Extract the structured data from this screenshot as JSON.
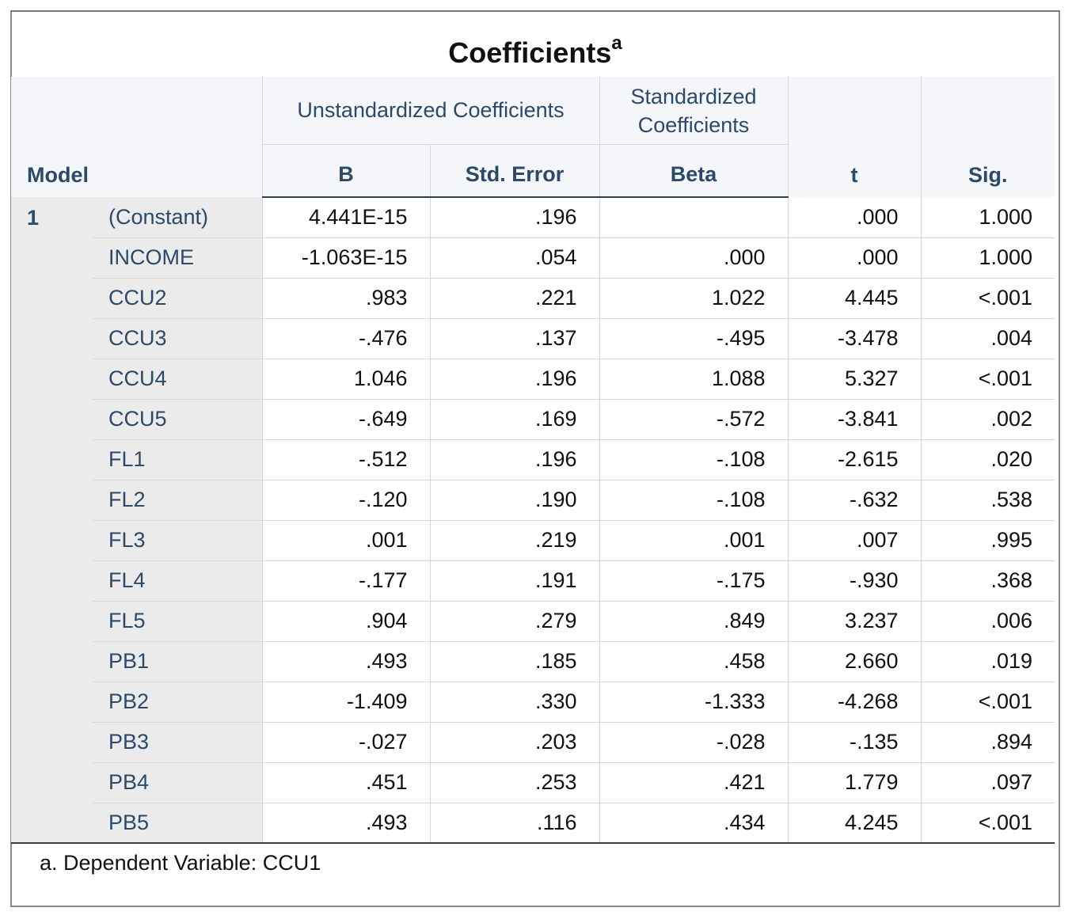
{
  "title": "Coefficients",
  "title_superscript": "a",
  "headers": {
    "model": "Model",
    "unstandardized": "Unstandardized Coefficients",
    "standardized": "Standardized Coefficients",
    "b": "B",
    "std_error": "Std. Error",
    "beta": "Beta",
    "t": "t",
    "sig": "Sig."
  },
  "model_number": "1",
  "rows": [
    {
      "var": "(Constant)",
      "b": "4.441E-15",
      "se": ".196",
      "beta": "",
      "t": ".000",
      "sig": "1.000"
    },
    {
      "var": "INCOME",
      "b": "-1.063E-15",
      "se": ".054",
      "beta": ".000",
      "t": ".000",
      "sig": "1.000"
    },
    {
      "var": "CCU2",
      "b": ".983",
      "se": ".221",
      "beta": "1.022",
      "t": "4.445",
      "sig": "<.001"
    },
    {
      "var": "CCU3",
      "b": "-.476",
      "se": ".137",
      "beta": "-.495",
      "t": "-3.478",
      "sig": ".004"
    },
    {
      "var": "CCU4",
      "b": "1.046",
      "se": ".196",
      "beta": "1.088",
      "t": "5.327",
      "sig": "<.001"
    },
    {
      "var": "CCU5",
      "b": "-.649",
      "se": ".169",
      "beta": "-.572",
      "t": "-3.841",
      "sig": ".002"
    },
    {
      "var": "FL1",
      "b": "-.512",
      "se": ".196",
      "beta": "-.108",
      "t": "-2.615",
      "sig": ".020"
    },
    {
      "var": "FL2",
      "b": "-.120",
      "se": ".190",
      "beta": "-.108",
      "t": "-.632",
      "sig": ".538"
    },
    {
      "var": "FL3",
      "b": ".001",
      "se": ".219",
      "beta": ".001",
      "t": ".007",
      "sig": ".995"
    },
    {
      "var": "FL4",
      "b": "-.177",
      "se": ".191",
      "beta": "-.175",
      "t": "-.930",
      "sig": ".368"
    },
    {
      "var": "FL5",
      "b": ".904",
      "se": ".279",
      "beta": ".849",
      "t": "3.237",
      "sig": ".006"
    },
    {
      "var": "PB1",
      "b": ".493",
      "se": ".185",
      "beta": ".458",
      "t": "2.660",
      "sig": ".019"
    },
    {
      "var": "PB2",
      "b": "-1.409",
      "se": ".330",
      "beta": "-1.333",
      "t": "-4.268",
      "sig": "<.001"
    },
    {
      "var": "PB3",
      "b": "-.027",
      "se": ".203",
      "beta": "-.028",
      "t": "-.135",
      "sig": ".894"
    },
    {
      "var": "PB4",
      "b": ".451",
      "se": ".253",
      "beta": ".421",
      "t": "1.779",
      "sig": ".097"
    },
    {
      "var": "PB5",
      "b": ".493",
      "se": ".116",
      "beta": ".434",
      "t": "4.245",
      "sig": "<.001"
    }
  ],
  "footnote": "a. Dependent Variable: CCU1"
}
